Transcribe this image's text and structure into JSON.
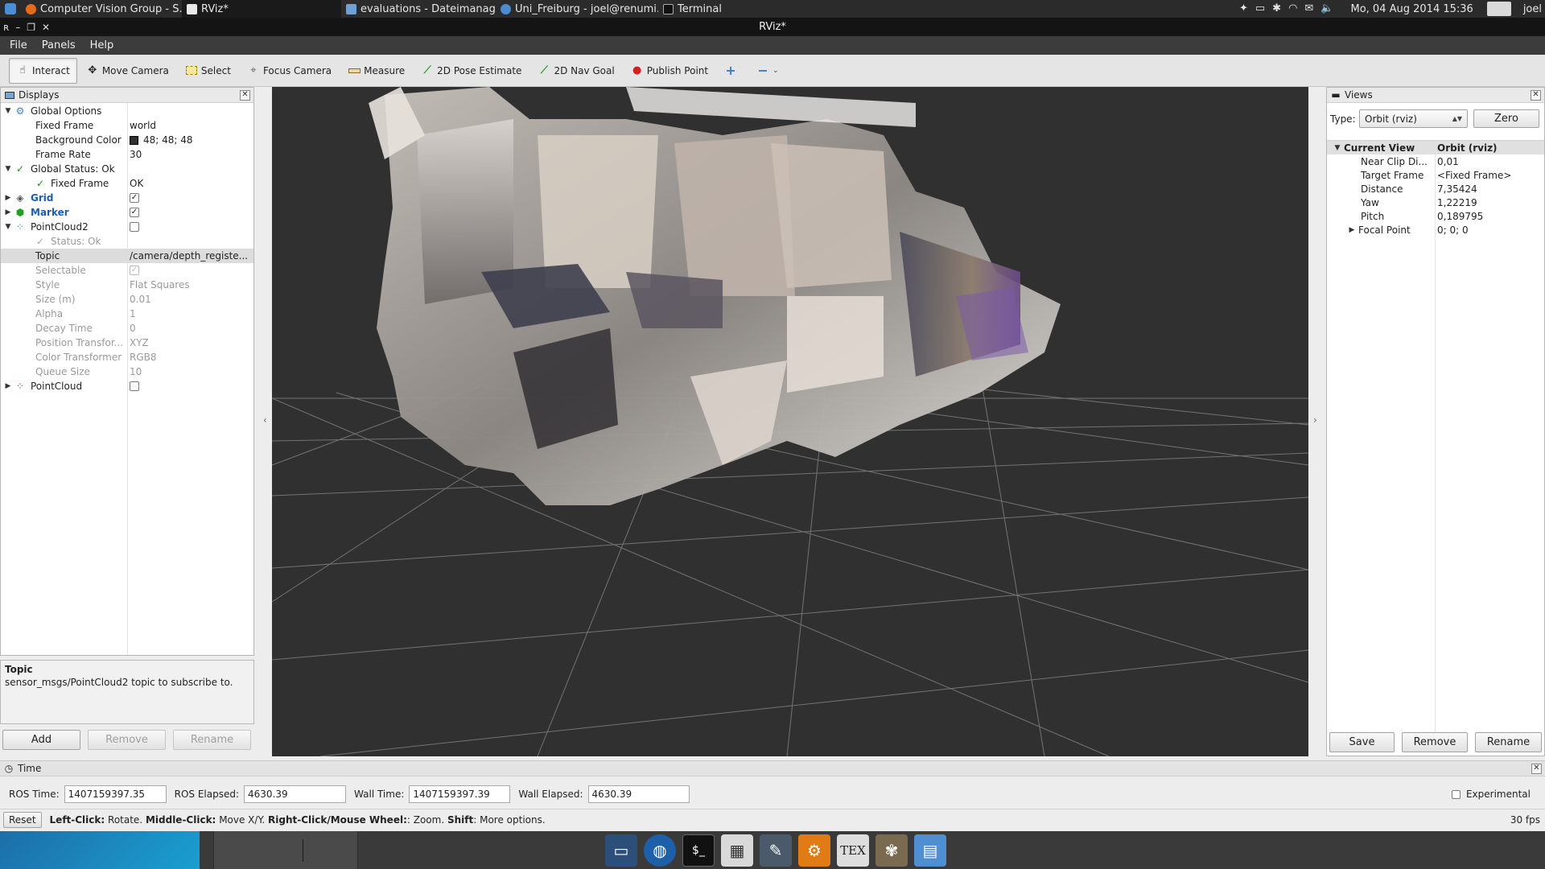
{
  "taskbar": {
    "apps": [
      {
        "label": "Computer Vision Group - S...",
        "icon": "firefox-icon",
        "active": false
      },
      {
        "label": "RViz*",
        "icon": "rviz-icon",
        "active": true
      },
      {
        "label": "evaluations - Dateimanager",
        "icon": "folder-icon",
        "active": false
      },
      {
        "label": "Uni_Freiburg - joel@renumi...",
        "icon": "network-icon",
        "active": false
      },
      {
        "label": "Terminal",
        "icon": "terminal-icon",
        "active": false
      }
    ],
    "clock": "Mo, 04 Aug 2014 15:36",
    "user": "joel"
  },
  "window": {
    "title": "RViz*"
  },
  "menu": {
    "file": "File",
    "panels": "Panels",
    "help": "Help"
  },
  "toolbar": {
    "interact": "Interact",
    "move_camera": "Move Camera",
    "select": "Select",
    "focus_camera": "Focus Camera",
    "measure": "Measure",
    "pose_estimate": "2D Pose Estimate",
    "nav_goal": "2D Nav Goal",
    "publish_point": "Publish Point"
  },
  "displays": {
    "title": "Displays",
    "global_options": "Global Options",
    "fixed_frame_label": "Fixed Frame",
    "fixed_frame_value": "world",
    "bg_color_label": "Background Color",
    "bg_color_value": "48; 48; 48",
    "frame_rate_label": "Frame Rate",
    "frame_rate_value": "30",
    "global_status": "Global Status: Ok",
    "status_fixed_frame_label": "Fixed Frame",
    "status_fixed_frame_value": "OK",
    "grid": "Grid",
    "marker": "Marker",
    "pointcloud2": "PointCloud2",
    "pc2_status": "Status: Ok",
    "topic_label": "Topic",
    "topic_value": "/camera/depth_registe...",
    "selectable_label": "Selectable",
    "style_label": "Style",
    "style_value": "Flat Squares",
    "size_label": "Size (m)",
    "size_value": "0.01",
    "alpha_label": "Alpha",
    "alpha_value": "1",
    "decay_label": "Decay Time",
    "decay_value": "0",
    "pos_transformer_label": "Position Transfor...",
    "pos_transformer_value": "XYZ",
    "color_transformer_label": "Color Transformer",
    "color_transformer_value": "RGB8",
    "queue_size_label": "Queue Size",
    "queue_size_value": "10",
    "pointcloud": "PointCloud"
  },
  "description": {
    "title": "Topic",
    "text": "sensor_msgs/PointCloud2 topic to subscribe to."
  },
  "display_buttons": {
    "add": "Add",
    "remove": "Remove",
    "rename": "Rename"
  },
  "views": {
    "title": "Views",
    "type_label": "Type:",
    "type_value": "Orbit (rviz)",
    "zero": "Zero",
    "current_view": "Current View",
    "current_view_type": "Orbit (rviz)",
    "near_clip_label": "Near Clip Di...",
    "near_clip_value": "0,01",
    "target_frame_label": "Target Frame",
    "target_frame_value": "<Fixed Frame>",
    "distance_label": "Distance",
    "distance_value": "7,35424",
    "yaw_label": "Yaw",
    "yaw_value": "1,22219",
    "pitch_label": "Pitch",
    "pitch_value": "0,189795",
    "focal_point_label": "Focal Point",
    "focal_point_value": "0; 0; 0",
    "save": "Save",
    "remove": "Remove",
    "rename": "Rename"
  },
  "time": {
    "title": "Time",
    "ros_time_label": "ROS Time:",
    "ros_time_value": "1407159397.35",
    "ros_elapsed_label": "ROS Elapsed:",
    "ros_elapsed_value": "4630.39",
    "wall_time_label": "Wall Time:",
    "wall_time_value": "1407159397.39",
    "wall_elapsed_label": "Wall Elapsed:",
    "wall_elapsed_value": "4630.39",
    "experimental": "Experimental"
  },
  "status": {
    "reset": "Reset",
    "left_click": "Left-Click:",
    "left_click_desc": "Rotate.",
    "middle_click": "Middle-Click:",
    "middle_click_desc": "Move X/Y.",
    "right_click": "Right-Click/Mouse Wheel:",
    "right_click_desc": ": Zoom.",
    "shift": "Shift",
    "shift_desc": ": More options.",
    "fps": "30 fps"
  },
  "dock": {
    "launchers": [
      "display-icon",
      "browser-icon",
      "terminal-icon",
      "workspace-icon",
      "editor-icon",
      "settings-icon",
      "tex-icon",
      "gimp-icon",
      "files-icon"
    ],
    "tex_label": "TEX"
  },
  "colors": {
    "viewport_bg": "#303030",
    "grid_line": "#8a8a8a",
    "link_blue": "#1f5db0",
    "ok_green": "#1a8a1a"
  }
}
